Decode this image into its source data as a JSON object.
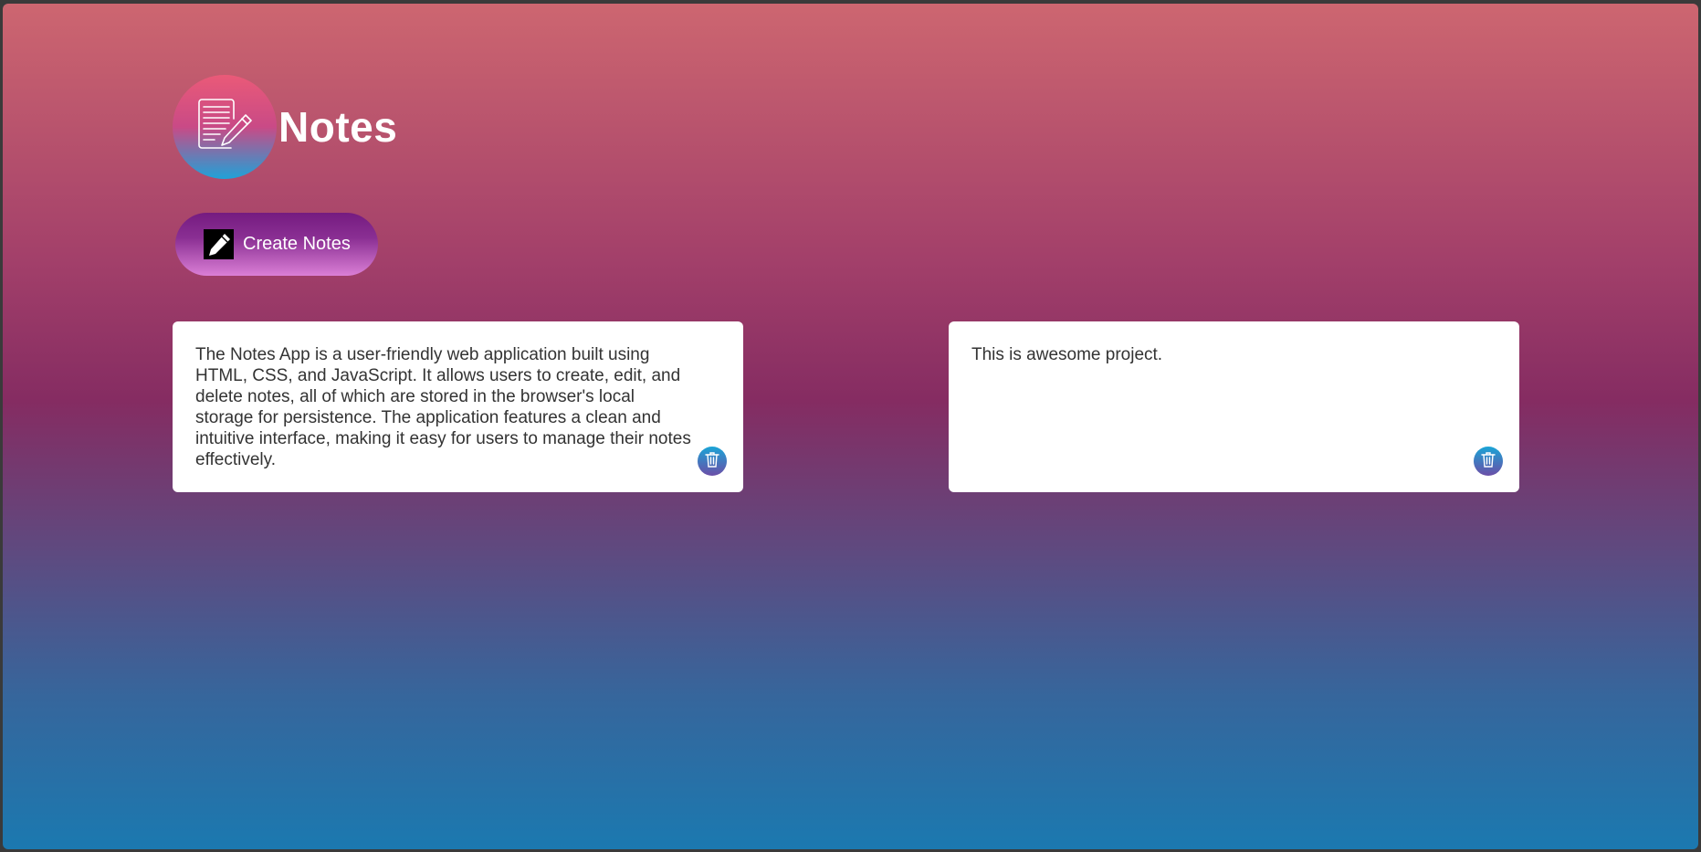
{
  "app": {
    "title": "Notes",
    "logo_icon": "notepad-pencil-icon"
  },
  "toolbar": {
    "create_label": "Create Notes",
    "create_icon": "pencil-icon"
  },
  "notes": [
    {
      "text": "The Notes App is a user-friendly web application built using\nHTML, CSS, and JavaScript. It allows users to create, edit, and\ndelete notes, all of which are stored in the browser's local\nstorage for persistence. The application features a clean and\nintuitive interface, making it easy for users to manage their notes\neffectively.",
      "delete_icon": "trash-icon"
    },
    {
      "text": "This is awesome project.",
      "delete_icon": "trash-icon"
    }
  ],
  "colors": {
    "background_top": "#cd6670",
    "background_middle": "#852c62",
    "background_bottom": "#1b79b0",
    "button_top": "#751b80",
    "button_bottom": "#db7fd6",
    "delete_top": "#1aa4d6",
    "delete_bottom": "#6b4ea8"
  }
}
